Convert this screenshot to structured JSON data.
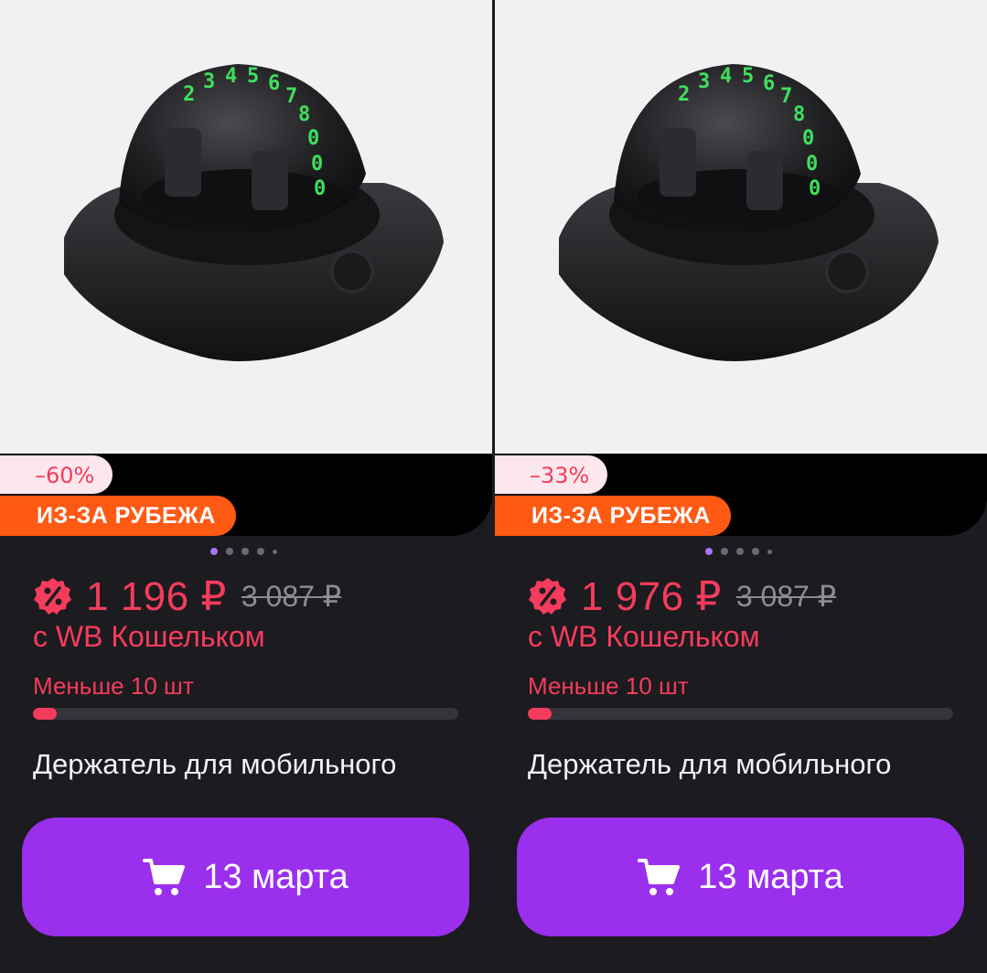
{
  "products": [
    {
      "discount": "–60%",
      "origin_badge": "ИЗ-ЗА РУБЕЖА",
      "price": "1 196 ₽",
      "old_price": "3 087 ₽",
      "wallet_caption": "с WB Кошельком",
      "stock_label": "Меньше 10 шт",
      "stock_level_fraction": 0.055,
      "name": "Держатель для мобильного",
      "button_label": "13 марта",
      "image_icon": "phone-holder-photo",
      "gallery_dots": 5,
      "gallery_active_index": 0
    },
    {
      "discount": "–33%",
      "origin_badge": "ИЗ-ЗА РУБЕЖА",
      "price": "1 976 ₽",
      "old_price": "3 087 ₽",
      "wallet_caption": "с WB Кошельком",
      "stock_label": "Меньше 10 шт",
      "stock_level_fraction": 0.055,
      "name": "Держатель для мобильного",
      "button_label": "13 марта",
      "image_icon": "phone-holder-photo",
      "gallery_dots": 5,
      "gallery_active_index": 0
    }
  ],
  "colors": {
    "accent_pink": "#f53c5c",
    "button_purple": "#9b2fee",
    "origin_orange": "#ff5a14",
    "background": "#1c1b20"
  }
}
